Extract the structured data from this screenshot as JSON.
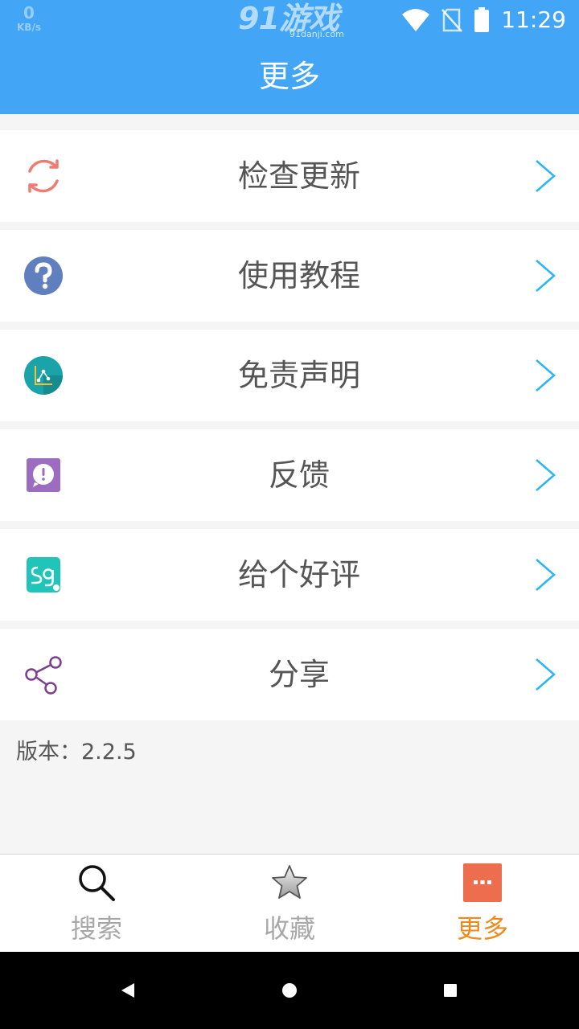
{
  "status_bar": {
    "net_speed_value": "0",
    "net_speed_unit": "KB/s",
    "logo_text": "91游戏",
    "logo_subtext": "91danji.com",
    "time": "11:29",
    "icons": [
      "wifi-icon",
      "no-sim-icon",
      "battery-icon"
    ]
  },
  "header": {
    "title": "更多"
  },
  "menu": {
    "items": [
      {
        "label": "检查更新",
        "icon": "refresh-icon"
      },
      {
        "label": "使用教程",
        "icon": "question-icon"
      },
      {
        "label": "免责声明",
        "icon": "disclaimer-icon"
      },
      {
        "label": "反馈",
        "icon": "feedback-icon"
      },
      {
        "label": "给个好评",
        "icon": "rate-icon"
      },
      {
        "label": "分享",
        "icon": "share-icon"
      }
    ],
    "chevron_icon": "chevron-right-icon"
  },
  "footer": {
    "version_text": "版本：2.2.5"
  },
  "tabbar": {
    "tabs": [
      {
        "label": "搜索",
        "icon": "search-icon",
        "active": false
      },
      {
        "label": "收藏",
        "icon": "star-icon",
        "active": false
      },
      {
        "label": "更多",
        "icon": "more-icon",
        "active": true
      }
    ]
  },
  "nav_bar": {
    "buttons": [
      "back-icon",
      "home-icon",
      "recents-icon"
    ]
  },
  "colors": {
    "header_bg": "#42a5f5",
    "active_tab": "#f08a1c",
    "chevron": "#29b6f6",
    "page_bg": "#f5f5f5"
  }
}
